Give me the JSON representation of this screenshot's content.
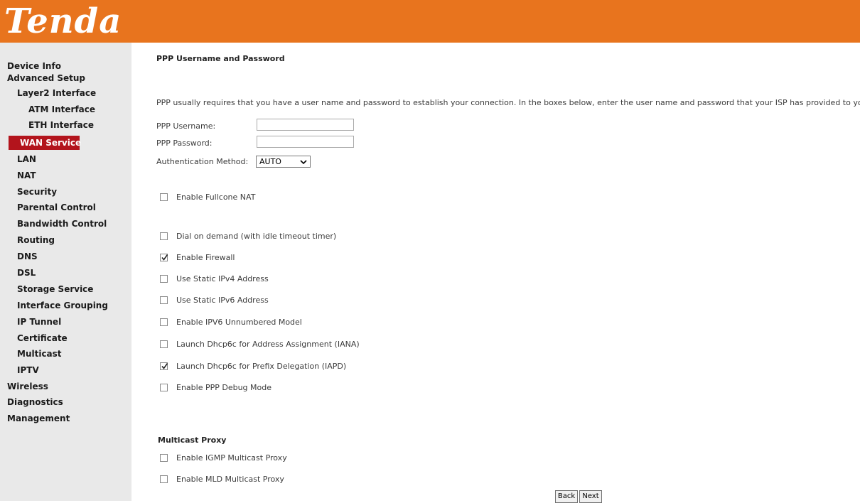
{
  "header": {
    "logo_text": "Tenda",
    "bar_color": "#e8741e"
  },
  "sidebar": {
    "items": [
      {
        "label": "Device Info",
        "level": 0
      },
      {
        "label": "Advanced Setup",
        "level": 0
      },
      {
        "label": "Layer2 Interface",
        "level": 1
      },
      {
        "label": "ATM Interface",
        "level": 2
      },
      {
        "label": "ETH Interface",
        "level": 2
      },
      {
        "label": "WAN Service",
        "level": 1,
        "active": true
      },
      {
        "label": "LAN",
        "level": 1
      },
      {
        "label": "NAT",
        "level": 1
      },
      {
        "label": "Security",
        "level": 1
      },
      {
        "label": "Parental Control",
        "level": 1
      },
      {
        "label": "Bandwidth Control",
        "level": 1
      },
      {
        "label": "Routing",
        "level": 1
      },
      {
        "label": "DNS",
        "level": 1
      },
      {
        "label": "DSL",
        "level": 1
      },
      {
        "label": "Storage Service",
        "level": 1
      },
      {
        "label": "Interface Grouping",
        "level": 1
      },
      {
        "label": "IP Tunnel",
        "level": 1
      },
      {
        "label": "Certificate",
        "level": 1
      },
      {
        "label": "Multicast",
        "level": 1
      },
      {
        "label": "IPTV",
        "level": 1
      },
      {
        "label": "Wireless",
        "level": 0
      },
      {
        "label": "Diagnostics",
        "level": 0
      },
      {
        "label": "Management",
        "level": 0
      }
    ],
    "active_color": "#b3141c"
  },
  "main": {
    "section_title": "PPP Username and Password",
    "description": "PPP usually requires that you have a user name and password to establish your connection. In the boxes below, enter the user name and password that your ISP has provided to you",
    "username_label": "PPP Username:",
    "username_value": "",
    "password_label": "PPP Password:",
    "password_value": "",
    "auth_label": "Authentication Method:",
    "auth_value": "AUTO",
    "options": [
      {
        "label": "Enable Fullcone NAT",
        "checked": false
      },
      {
        "label": "Dial on demand (with idle timeout timer)",
        "checked": false
      },
      {
        "label": "Enable Firewall",
        "checked": true
      },
      {
        "label": "Use Static IPv4 Address",
        "checked": false
      },
      {
        "label": "Use Static IPv6 Address",
        "checked": false
      },
      {
        "label": "Enable IPV6 Unnumbered Model",
        "checked": false
      },
      {
        "label": "Launch Dhcp6c for Address Assignment (IANA)",
        "checked": false
      },
      {
        "label": "Launch Dhcp6c for Prefix Delegation (IAPD)",
        "checked": true
      },
      {
        "label": "Enable PPP Debug Mode",
        "checked": false
      }
    ],
    "multicast_title": "Multicast Proxy",
    "multicast_options": [
      {
        "label": "Enable IGMP Multicast Proxy",
        "checked": false
      },
      {
        "label": "Enable MLD Multicast Proxy",
        "checked": false
      }
    ],
    "back_label": "Back",
    "next_label": "Next"
  }
}
